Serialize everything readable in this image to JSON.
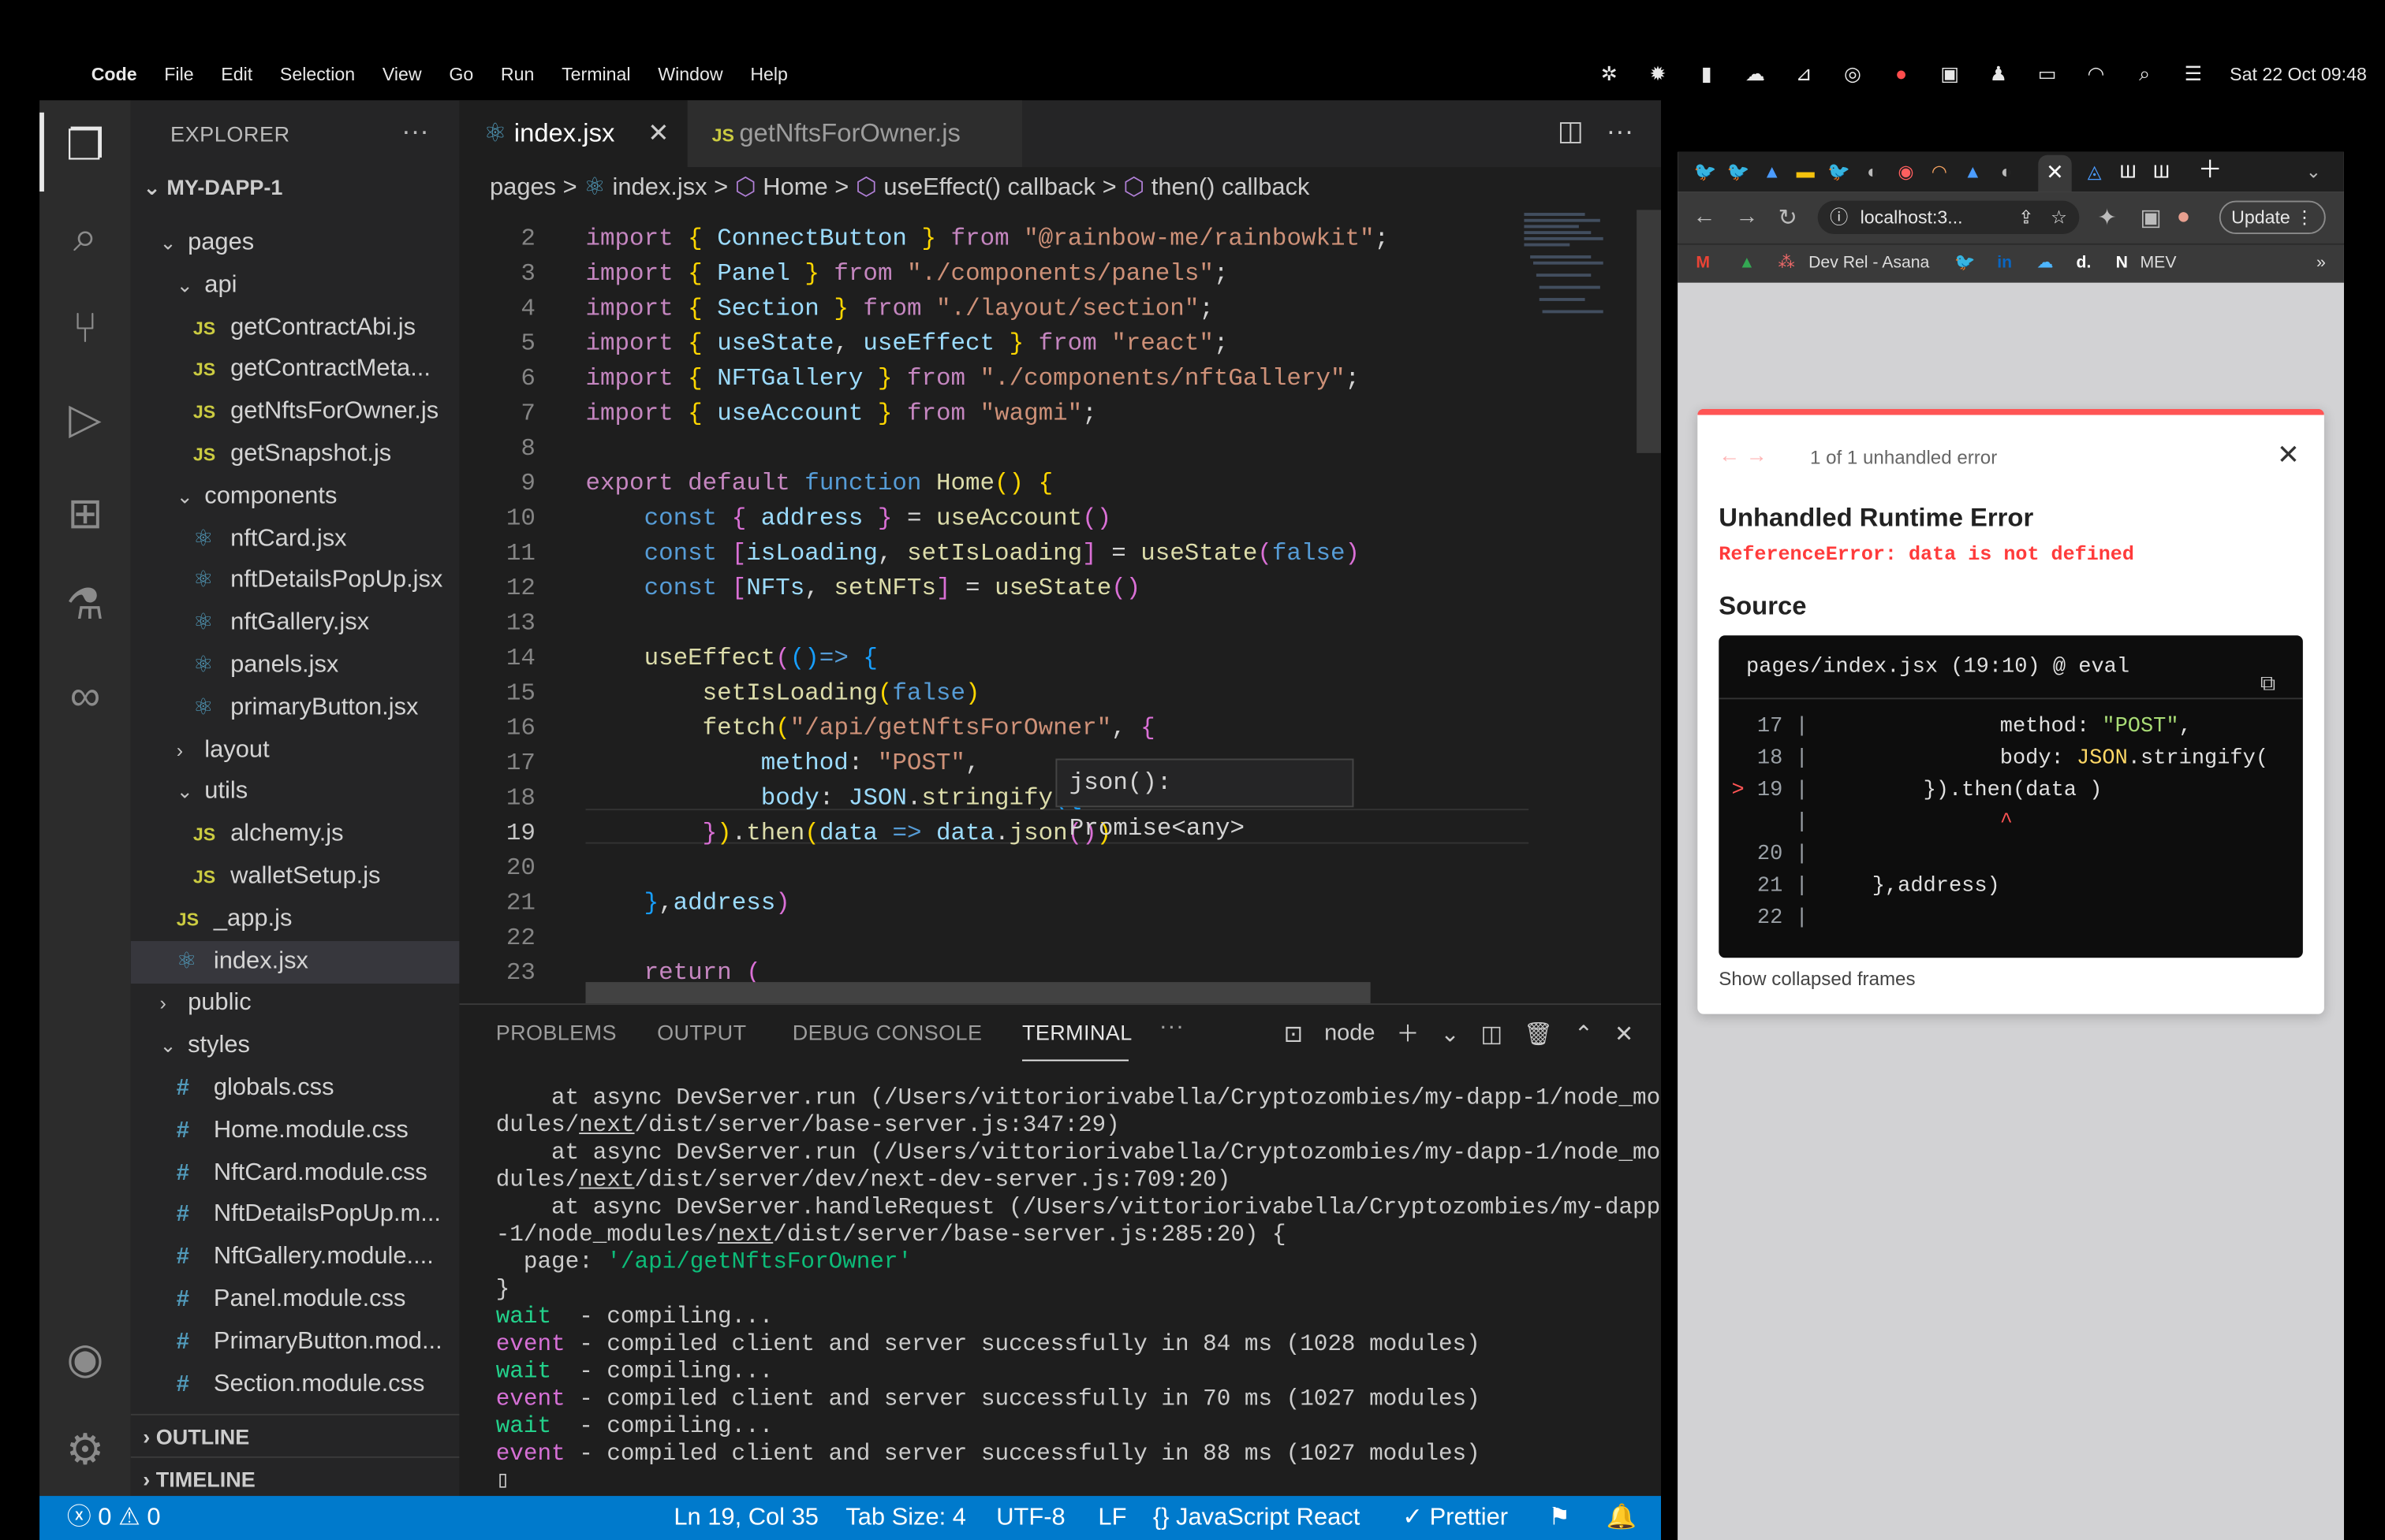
{
  "menubar": {
    "apple": "",
    "app": "Code",
    "items": [
      "File",
      "Edit",
      "Selection",
      "View",
      "Go",
      "Run",
      "Terminal",
      "Window",
      "Help"
    ],
    "datetime": "Sat 22 Oct  09:48"
  },
  "explorer": {
    "title": "EXPLORER",
    "root": "MY-DAPP-1",
    "items": [
      {
        "label": "pages",
        "type": "folder",
        "open": true,
        "depth": 1
      },
      {
        "label": "api",
        "type": "folder",
        "open": true,
        "depth": 2
      },
      {
        "label": "getContractAbi.js",
        "type": "js",
        "depth": 3
      },
      {
        "label": "getContractMeta...",
        "type": "js",
        "depth": 3
      },
      {
        "label": "getNftsForOwner.js",
        "type": "js",
        "depth": 3
      },
      {
        "label": "getSnapshot.js",
        "type": "js",
        "depth": 3
      },
      {
        "label": "components",
        "type": "folder",
        "open": true,
        "depth": 2
      },
      {
        "label": "nftCard.jsx",
        "type": "jsx",
        "depth": 3
      },
      {
        "label": "nftDetailsPopUp.jsx",
        "type": "jsx",
        "depth": 3
      },
      {
        "label": "nftGallery.jsx",
        "type": "jsx",
        "depth": 3
      },
      {
        "label": "panels.jsx",
        "type": "jsx",
        "depth": 3
      },
      {
        "label": "primaryButton.jsx",
        "type": "jsx",
        "depth": 3
      },
      {
        "label": "layout",
        "type": "folder",
        "open": false,
        "depth": 2
      },
      {
        "label": "utils",
        "type": "folder",
        "open": true,
        "depth": 2
      },
      {
        "label": "alchemy.js",
        "type": "js",
        "depth": 3
      },
      {
        "label": "walletSetup.js",
        "type": "js",
        "depth": 3
      },
      {
        "label": "_app.js",
        "type": "js",
        "depth": 2
      },
      {
        "label": "index.jsx",
        "type": "jsx",
        "depth": 2,
        "selected": true
      },
      {
        "label": "public",
        "type": "folder",
        "open": false,
        "depth": 1
      },
      {
        "label": "styles",
        "type": "folder",
        "open": true,
        "depth": 1
      },
      {
        "label": "globals.css",
        "type": "css",
        "depth": 2
      },
      {
        "label": "Home.module.css",
        "type": "css",
        "depth": 2
      },
      {
        "label": "NftCard.module.css",
        "type": "css",
        "depth": 2
      },
      {
        "label": "NftDetailsPopUp.m...",
        "type": "css",
        "depth": 2
      },
      {
        "label": "NftGallery.module....",
        "type": "css",
        "depth": 2
      },
      {
        "label": "Panel.module.css",
        "type": "css",
        "depth": 2
      },
      {
        "label": "PrimaryButton.mod...",
        "type": "css",
        "depth": 2
      },
      {
        "label": "Section.module.css",
        "type": "css",
        "depth": 2
      }
    ],
    "outline": "OUTLINE",
    "timeline": "TIMELINE"
  },
  "tabs": [
    {
      "label": "index.jsx",
      "active": true
    },
    {
      "label": "getNftsForOwner.js",
      "active": false
    }
  ],
  "breadcrumb": [
    "pages",
    ">",
    "index.jsx",
    ">",
    "Home",
    ">",
    "useEffect() callback",
    ">",
    "then() callback"
  ],
  "editor": {
    "current_line": "19",
    "hover": "json(): Promise<any>"
  },
  "panel": {
    "tabs": [
      "PROBLEMS",
      "OUTPUT",
      "DEBUG CONSOLE",
      "TERMINAL"
    ],
    "active": "TERMINAL",
    "shell": "node"
  },
  "statusbar": {
    "errors": "0",
    "warnings": "0",
    "position": "Ln 19, Col 35",
    "tabsize": "Tab Size: 4",
    "encoding": "UTF-8",
    "eol": "LF",
    "language": "JavaScript React",
    "formatter": "Prettier"
  },
  "browser": {
    "url": "localhost:3...",
    "update": "Update",
    "bookmarks": [
      "Dev Rel - Asana",
      "MEV"
    ],
    "error": {
      "count": "1 of 1 unhandled error",
      "title": "Unhandled Runtime Error",
      "message": "ReferenceError: data is not defined",
      "source": "Source",
      "file": "pages/index.jsx (19:10) @ eval",
      "collapsed": "Show collapsed frames"
    }
  },
  "colors": {
    "statusbar": "#007acc",
    "error": "#ff5555",
    "editor_bg": "#1e1e1e",
    "sidebar_bg": "#252526"
  }
}
